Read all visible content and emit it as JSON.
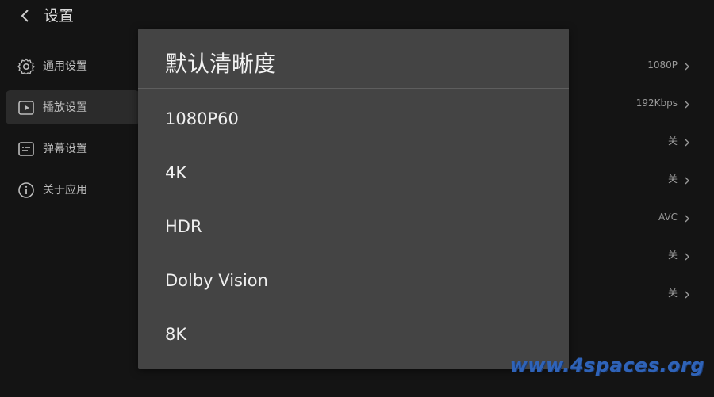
{
  "header": {
    "back_icon": "chevron-left-icon",
    "title": "设置"
  },
  "sidebar": {
    "items": [
      {
        "label": "通用设置",
        "icon": "gear-icon",
        "active": false
      },
      {
        "label": "播放设置",
        "icon": "play-icon",
        "active": true
      },
      {
        "label": "弹幕设置",
        "icon": "danmaku-icon",
        "active": false
      },
      {
        "label": "关于应用",
        "icon": "info-icon",
        "active": false
      }
    ]
  },
  "settings_values": [
    {
      "value": "1080P"
    },
    {
      "value": "192Kbps"
    },
    {
      "value": "关"
    },
    {
      "value": "关"
    },
    {
      "value": "AVC"
    },
    {
      "value": "关"
    },
    {
      "value": "关"
    }
  ],
  "dialog": {
    "title": "默认清晰度",
    "options": [
      {
        "label": "1080P60"
      },
      {
        "label": "4K"
      },
      {
        "label": "HDR"
      },
      {
        "label": "Dolby Vision"
      },
      {
        "label": "8K"
      }
    ]
  },
  "watermark": "www.4spaces.org",
  "colors": {
    "background": "#141414",
    "dialog_bg": "#444444",
    "active_item_bg": "#2b2b2b",
    "watermark": "#2f63b8"
  }
}
